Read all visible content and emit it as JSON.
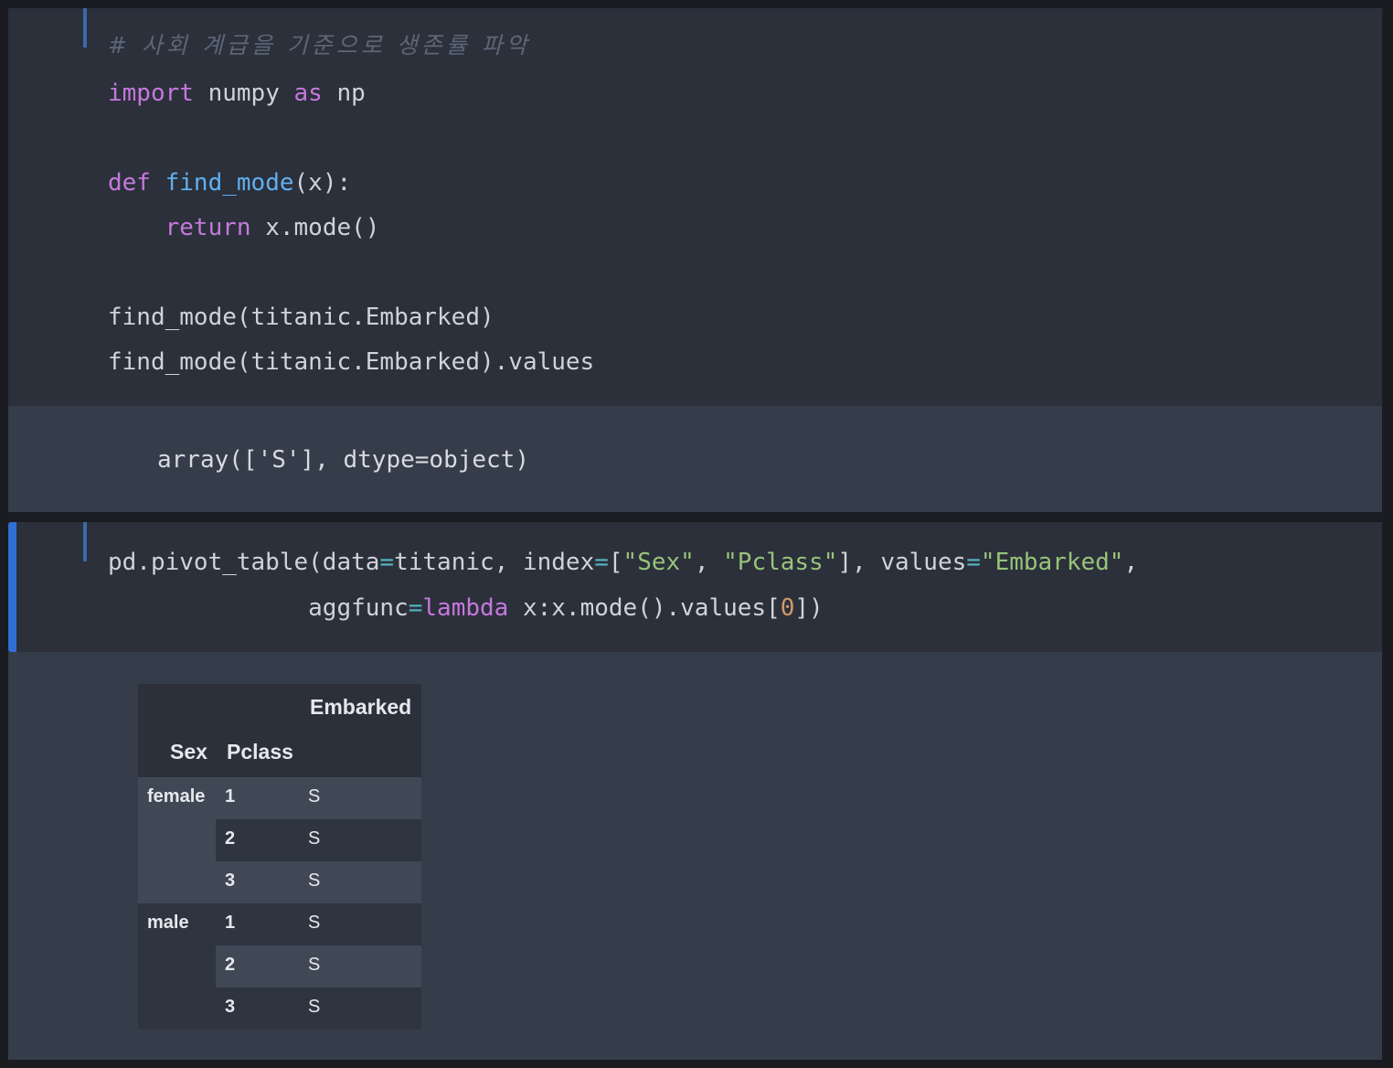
{
  "cell1": {
    "comment": "# 사회 계급을 기준으로 생존률 파악",
    "import_kw": "import",
    "import_mod": " numpy ",
    "as_kw": "as",
    "alias": " np",
    "def_kw": "def",
    "fn_name": "find_mode",
    "def_args": "(x):",
    "return_kw": "return",
    "return_expr": " x.mode()",
    "call1": "find_mode(titanic.Embarked)",
    "call2": "find_mode(titanic.Embarked).values",
    "output": "array(['S'], dtype=object)"
  },
  "cell2": {
    "p1": "pd.pivot_table(data",
    "eq": "=",
    "p2": "titanic, index",
    "p3": "[",
    "s1": "\"Sex\"",
    "p4": ", ",
    "s2": "\"Pclass\"",
    "p5": "], values",
    "s3": "\"Embarked\"",
    "p6": ",",
    "l2a": "              aggfunc",
    "lambda_kw": "lambda",
    "l2b": " x:x.mode().values[",
    "zero": "0",
    "l2c": "])"
  },
  "table": {
    "col_header": "Embarked",
    "index_names": [
      "Sex",
      "Pclass"
    ],
    "rows": [
      {
        "sex": "female",
        "pclass": "1",
        "embarked": "S"
      },
      {
        "sex": "",
        "pclass": "2",
        "embarked": "S"
      },
      {
        "sex": "",
        "pclass": "3",
        "embarked": "S"
      },
      {
        "sex": "male",
        "pclass": "1",
        "embarked": "S"
      },
      {
        "sex": "",
        "pclass": "2",
        "embarked": "S"
      },
      {
        "sex": "",
        "pclass": "3",
        "embarked": "S"
      }
    ]
  }
}
